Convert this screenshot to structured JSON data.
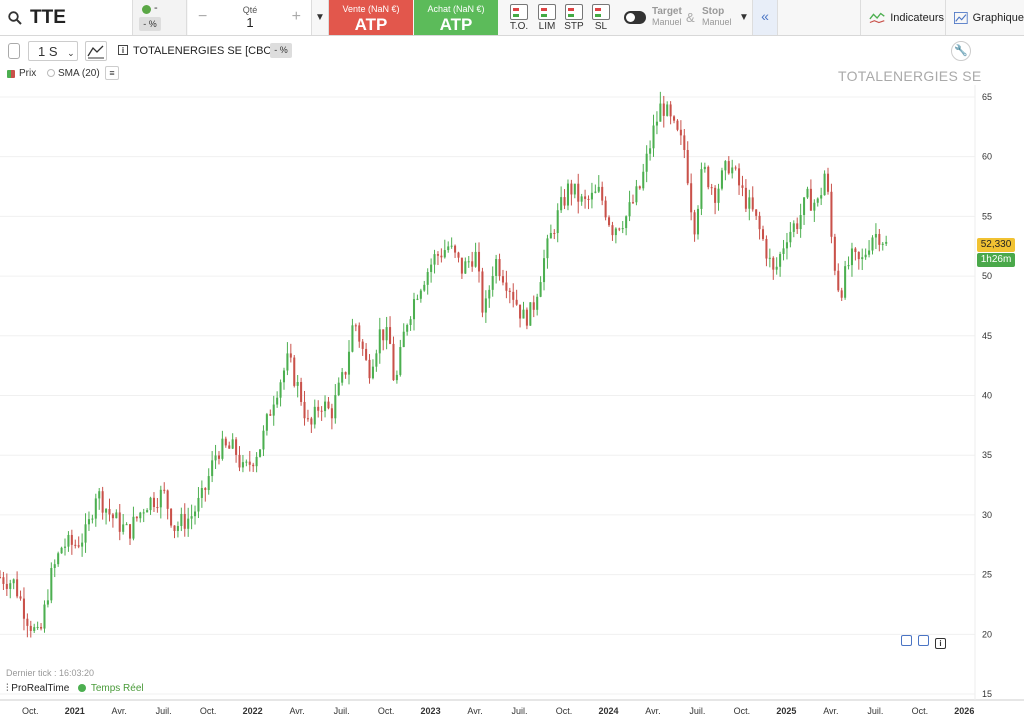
{
  "toolbar": {
    "symbol": "TTE",
    "change_dot_label": "-",
    "change_pct": "- %",
    "qty_label": "Qté",
    "qty_value": "1",
    "qty_minus": "−",
    "qty_plus": "+",
    "sell_title": "Vente (NaN €)",
    "sell_value": "ATP",
    "buy_title": "Achat (NaN €)",
    "buy_value": "ATP",
    "order_types": [
      "T.O.",
      "LIM",
      "STP",
      "SL"
    ],
    "target_label": "Target",
    "target_sub": "Manuel",
    "amp": "&",
    "stop_label": "Stop",
    "stop_sub": "Manuel",
    "collapse": "«",
    "indicators_label": "Indicateurs",
    "graph_label": "Graphique",
    "colors": {
      "sell": "#e2574c",
      "buy": "#5cbb5a",
      "up": "#4caf50",
      "down": "#c9514a",
      "last_tag": "#f1c232"
    }
  },
  "subbar": {
    "period": "1 S",
    "instrument_name": "TOTALENERGIES SE [CBOE]",
    "instrument_pct": "- %",
    "info": "i"
  },
  "legend": {
    "price": "Prix",
    "sma": "SMA (20)",
    "list_icon": "≡"
  },
  "watermark": "TOTALENERGIES SE",
  "price_tags": {
    "last": "52,330",
    "timer": "1h26m"
  },
  "footer": {
    "last_tick": "Dernier tick : 16:03:20",
    "brand": "ProRealTime",
    "realtime": "Temps Réel"
  },
  "chart_data": {
    "type": "candlestick",
    "title": "TOTALENERGIES SE",
    "period": "weekly",
    "ylim": [
      14.5,
      66
    ],
    "y_ticks": [
      15,
      20,
      25,
      30,
      35,
      40,
      45,
      50,
      55,
      60,
      65
    ],
    "x_ticks": [
      "Oct.",
      "2021",
      "Avr.",
      "Juil.",
      "Oct.",
      "2022",
      "Avr.",
      "Juil.",
      "Oct.",
      "2023",
      "Avr.",
      "Juil.",
      "Oct.",
      "2024",
      "Avr.",
      "Juil.",
      "Oct.",
      "2025",
      "Avr.",
      "Juil.",
      "Oct.",
      "2026"
    ],
    "x_tick_years": [
      2020.75,
      2021.0,
      2021.25,
      2021.5,
      2021.75,
      2022.0,
      2022.25,
      2022.5,
      2022.75,
      2023.0,
      2023.25,
      2023.5,
      2023.75,
      2024.0,
      2024.25,
      2024.5,
      2024.75,
      2025.0,
      2025.25,
      2025.5,
      2025.75,
      2026.0
    ],
    "start": 2020.58,
    "end": 2026.06,
    "waypoints": [
      [
        2020.58,
        24.8
      ],
      [
        2020.66,
        24.3
      ],
      [
        2020.73,
        21.5
      ],
      [
        2020.8,
        19.5
      ],
      [
        2020.86,
        24.5
      ],
      [
        2020.93,
        27.5
      ],
      [
        2021.0,
        27.5
      ],
      [
        2021.07,
        28.5
      ],
      [
        2021.12,
        32.0
      ],
      [
        2021.2,
        30.0
      ],
      [
        2021.3,
        28.5
      ],
      [
        2021.4,
        31.0
      ],
      [
        2021.5,
        31.8
      ],
      [
        2021.56,
        29.0
      ],
      [
        2021.65,
        29.8
      ],
      [
        2021.72,
        31.5
      ],
      [
        2021.8,
        35.5
      ],
      [
        2021.9,
        35.5
      ],
      [
        2021.95,
        33.5
      ],
      [
        2022.05,
        36.0
      ],
      [
        2022.12,
        40.0
      ],
      [
        2022.2,
        43.0
      ],
      [
        2022.27,
        40.0
      ],
      [
        2022.32,
        37.0
      ],
      [
        2022.38,
        39.5
      ],
      [
        2022.44,
        38.5
      ],
      [
        2022.52,
        42.0
      ],
      [
        2022.57,
        46.5
      ],
      [
        2022.65,
        42.0
      ],
      [
        2022.72,
        45.5
      ],
      [
        2022.77,
        44.5
      ],
      [
        2022.8,
        40.5
      ],
      [
        2022.86,
        46.0
      ],
      [
        2022.93,
        49.0
      ],
      [
        2023.02,
        51.5
      ],
      [
        2023.1,
        52.5
      ],
      [
        2023.18,
        50.5
      ],
      [
        2023.25,
        52.0
      ],
      [
        2023.3,
        46.5
      ],
      [
        2023.36,
        51.5
      ],
      [
        2023.45,
        49.0
      ],
      [
        2023.52,
        46.5
      ],
      [
        2023.57,
        47.0
      ],
      [
        2023.63,
        51.0
      ],
      [
        2023.7,
        54.5
      ],
      [
        2023.78,
        57.5
      ],
      [
        2023.86,
        56.0
      ],
      [
        2023.95,
        57.0
      ],
      [
        2024.02,
        54.0
      ],
      [
        2024.1,
        55.0
      ],
      [
        2024.18,
        57.5
      ],
      [
        2024.25,
        62.0
      ],
      [
        2024.3,
        64.5
      ],
      [
        2024.36,
        62.5
      ],
      [
        2024.43,
        60.5
      ],
      [
        2024.48,
        54.0
      ],
      [
        2024.53,
        59.0
      ],
      [
        2024.6,
        57.0
      ],
      [
        2024.68,
        59.5
      ],
      [
        2024.75,
        57.0
      ],
      [
        2024.82,
        55.0
      ],
      [
        2024.88,
        52.5
      ],
      [
        2024.93,
        50.0
      ],
      [
        2025.0,
        53.5
      ],
      [
        2025.06,
        54.5
      ],
      [
        2025.12,
        56.5
      ],
      [
        2025.18,
        56.0
      ],
      [
        2025.22,
        59.0
      ],
      [
        2025.26,
        52.0
      ],
      [
        2025.3,
        48.5
      ],
      [
        2025.36,
        51.5
      ],
      [
        2025.42,
        51.0
      ],
      [
        2025.48,
        53.5
      ],
      [
        2025.53,
        53.5
      ],
      [
        2025.57,
        52.3
      ]
    ]
  }
}
